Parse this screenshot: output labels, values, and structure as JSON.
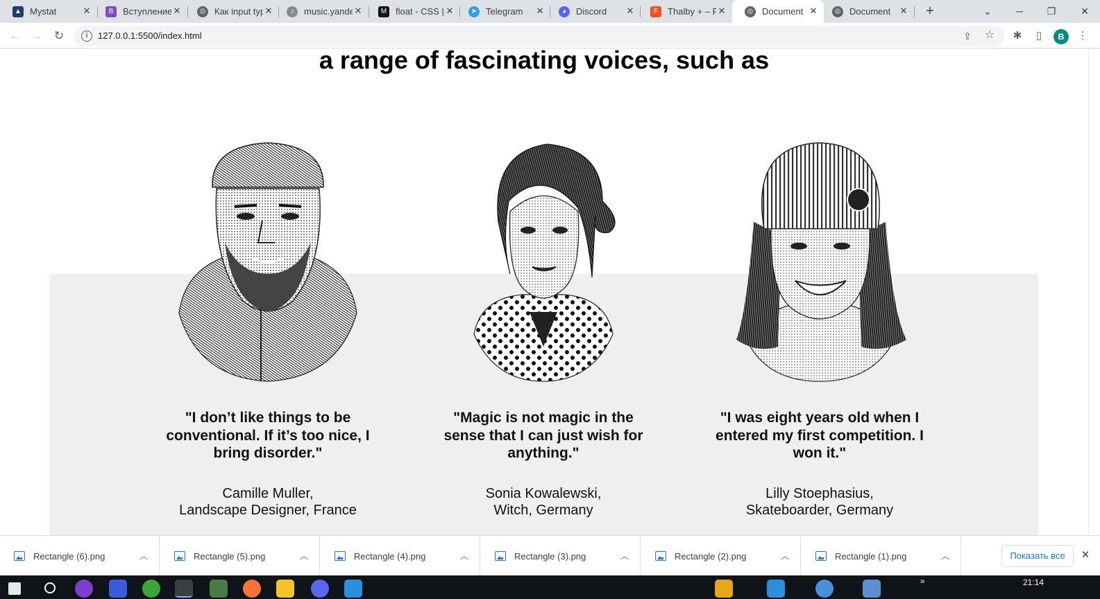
{
  "browser": {
    "tabs": [
      {
        "title": "Mystat",
        "icon": "graduation-cap-icon",
        "color": "#1f3b6f"
      },
      {
        "title": "Вступление.",
        "icon": "bootstrap-icon",
        "color": "#7952b3"
      },
      {
        "title": "Как input typ",
        "icon": "globe-icon",
        "color": "#5f6368"
      },
      {
        "title": "music.yande",
        "icon": "yandex-music-icon",
        "color": "#8a8a8a"
      },
      {
        "title": "float - CSS | I",
        "icon": "mdn-icon",
        "color": "#111111"
      },
      {
        "title": "Telegram",
        "icon": "telegram-icon",
        "color": "#2aa3e0"
      },
      {
        "title": "Discord",
        "icon": "discord-icon",
        "color": "#5865f2"
      },
      {
        "title": "Thalby + – Fi",
        "icon": "figma-icon",
        "color": "#f24e1e"
      },
      {
        "title": "Document",
        "icon": "globe-icon",
        "color": "#5f6368",
        "active": true
      },
      {
        "title": "Document",
        "icon": "globe-icon",
        "color": "#5f6368"
      }
    ],
    "url": "127.0.0.1:5500/index.html",
    "profile_initial": "B"
  },
  "page": {
    "heading": "a range of fascinating voices, such as",
    "people": [
      {
        "quote": "\"I don’t like things to be conventional. If it’s too nice, I bring disorder.\"",
        "name_line1": "Camille Muller,",
        "name_line2": "Landscape Designer, France"
      },
      {
        "quote": "\"Magic is not magic in the sense that I can just wish for anything.\"",
        "name_line1": "Sonia Kowalewski,",
        "name_line2": "Witch, Germany"
      },
      {
        "quote": "\"I was eight years old when I entered my first competition. I won it.\"",
        "name_line1": "Lilly Stoephasius,",
        "name_line2": "Skateboarder, Germany"
      }
    ],
    "band_color": "#efefef"
  },
  "downloads": {
    "items": [
      "Rectangle (6).png",
      "Rectangle (5).png",
      "Rectangle (4).png",
      "Rectangle (3).png",
      "Rectangle (2).png",
      "Rectangle (1).png"
    ],
    "show_all": "Показать все"
  },
  "taskbar": {
    "clock": "21:14"
  }
}
